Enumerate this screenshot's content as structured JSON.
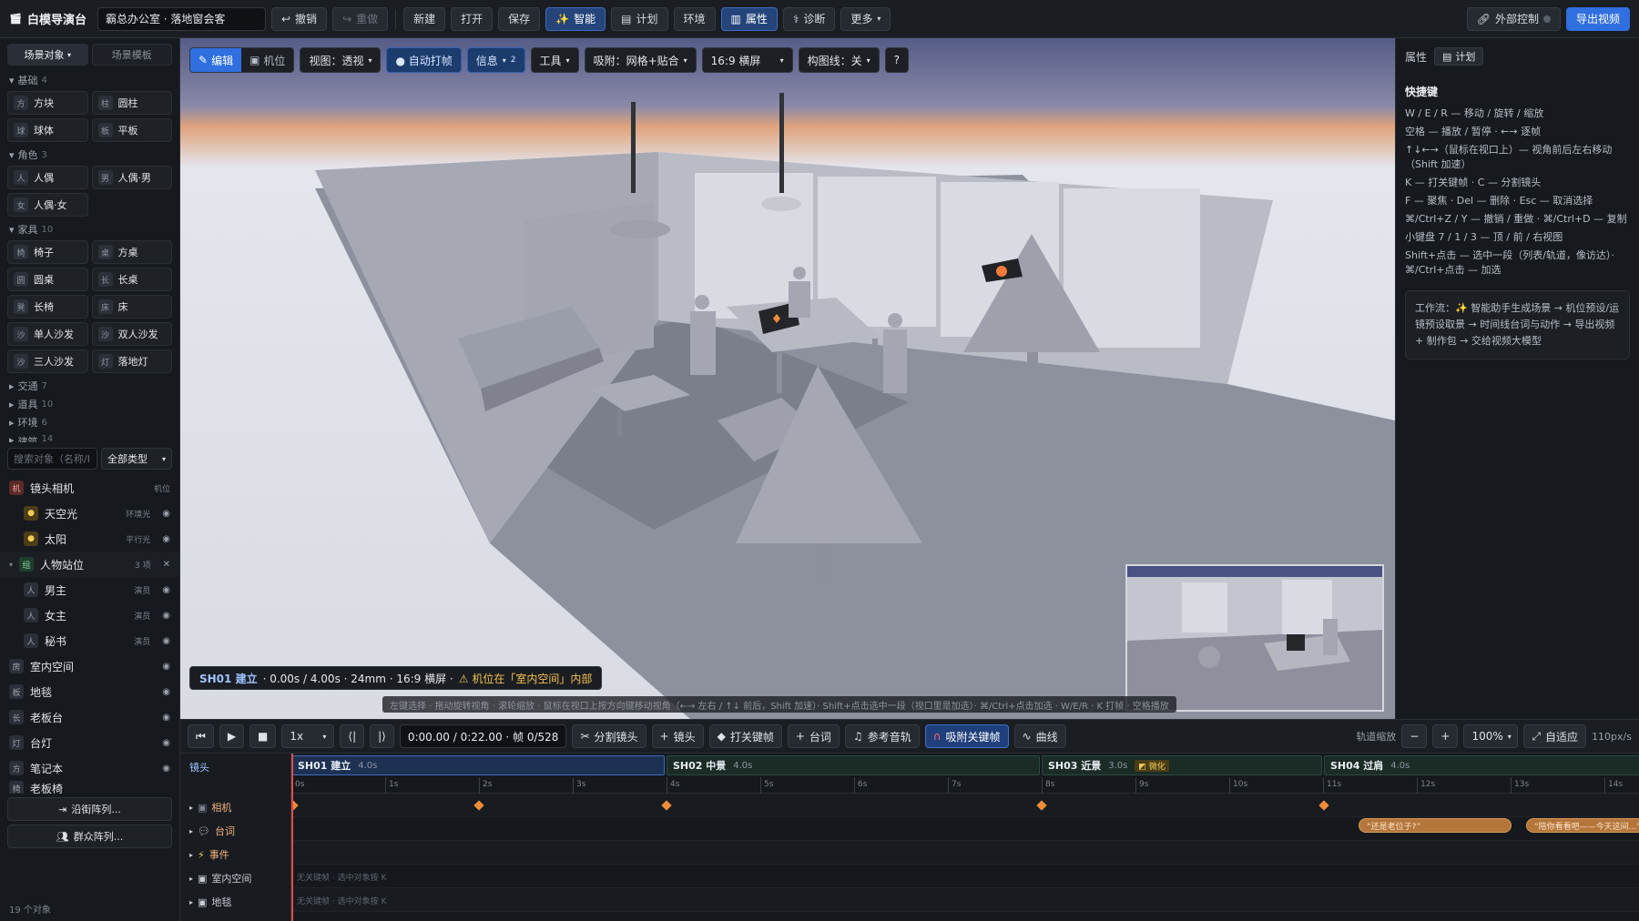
{
  "app": {
    "title": "白模导演台",
    "project": "霸总办公室 · 落地窗会客"
  },
  "toolbar": {
    "undo": "撤销",
    "redo": "重做",
    "new": "新建",
    "open": "打开",
    "save": "保存",
    "smart": "智能",
    "plan": "计划",
    "env": "环境",
    "props": "属性",
    "diag": "诊断",
    "more": "更多",
    "external": "外部控制",
    "export": "导出视频"
  },
  "left": {
    "tabs": [
      "场景对象",
      "场景模板"
    ],
    "categories": {
      "basic": {
        "label": "基础",
        "count": "4",
        "items": [
          [
            "方",
            "方块"
          ],
          [
            "柱",
            "圆柱"
          ],
          [
            "球",
            "球体"
          ],
          [
            "板",
            "平板"
          ]
        ]
      },
      "role": {
        "label": "角色",
        "count": "3",
        "items": [
          [
            "人",
            "人偶"
          ],
          [
            "男",
            "人偶·男"
          ],
          [
            "女",
            "人偶·女"
          ]
        ]
      },
      "furniture": {
        "label": "家具",
        "count": "10",
        "items": [
          [
            "椅",
            "椅子"
          ],
          [
            "桌",
            "方桌"
          ],
          [
            "圆",
            "圆桌"
          ],
          [
            "长",
            "长桌"
          ],
          [
            "凳",
            "长椅"
          ],
          [
            "床",
            "床"
          ],
          [
            "沙",
            "单人沙发"
          ],
          [
            "沙",
            "双人沙发"
          ],
          [
            "沙",
            "三人沙发"
          ],
          [
            "灯",
            "落地灯"
          ]
        ]
      },
      "traffic": {
        "label": "交通",
        "count": "7"
      },
      "props": {
        "label": "道具",
        "count": "10"
      },
      "env": {
        "label": "环境",
        "count": "6"
      },
      "build": {
        "label": "建筑",
        "count": "14"
      }
    },
    "search_placeholder": "搜索对象（名称/I",
    "type_filter": "全部类型",
    "objects": [
      {
        "icon": "机",
        "name": "镜头相机",
        "tag": "机位"
      },
      {
        "icon": "💡",
        "name": "天空光",
        "tag": "环境光"
      },
      {
        "icon": "💡",
        "name": "太阳",
        "tag": "平行光"
      },
      {
        "icon": "组",
        "name": "人物站位",
        "tag": "3 项"
      },
      {
        "icon": "人",
        "name": "男主",
        "tag": "演员"
      },
      {
        "icon": "人",
        "name": "女主",
        "tag": "演员"
      },
      {
        "icon": "人",
        "name": "秘书",
        "tag": "演员"
      },
      {
        "icon": "房",
        "name": "室内空间",
        "tag": ""
      },
      {
        "icon": "板",
        "name": "地毯",
        "tag": ""
      },
      {
        "icon": "长",
        "name": "老板台",
        "tag": ""
      },
      {
        "icon": "灯",
        "name": "台灯",
        "tag": ""
      },
      {
        "icon": "方",
        "name": "笔记本",
        "tag": ""
      },
      {
        "icon": "椅",
        "name": "老板椅",
        "tag": ""
      }
    ],
    "street_array": "沿街阵列...",
    "crowd_array": "群众阵列...",
    "count": "19 个对象"
  },
  "viewport": {
    "edit": "编辑",
    "cam": "机位",
    "view": "视图：透视",
    "autokey": "● 自动打帧",
    "info": "信息",
    "info_count": "2",
    "tools": "工具",
    "snap": "吸附：网格+贴合",
    "ratio": "16:9 横屏",
    "guides": "构图线：关",
    "help": "?",
    "shot_name": "SH01 建立",
    "shot_info": "· 0.00s / 4.00s · 24mm · 16:9 横屏 ·",
    "warning": "⚠ 机位在「室内空间」内部",
    "hint": "左键选择 · 拖动旋转视角 · 滚轮缩放 · 鼠标在视口上按方向键移动视角（←→ 左右 / ↑↓ 前后，Shift 加速）· Shift+点击选中一段（视口里是加选）· ⌘/Ctrl+点击加选 · W/E/R · K 打帧 · 空格播放",
    "colors": {
      "accent": "#2f6fe0",
      "warn": "#f3c24e"
    }
  },
  "right": {
    "title": "属性",
    "plan": "计划",
    "shortcuts_title": "快捷键",
    "shortcuts": [
      "W / E / R — 移动 / 旋转 / 缩放",
      "空格 — 播放 / 暂停 · ←→ 逐帧",
      "↑↓←→（鼠标在视口上）— 视角前后左右移动（Shift 加速）",
      "K — 打关键帧 · C — 分割镜头",
      "F — 聚焦 · Del — 删除 · Esc — 取消选择",
      "⌘/Ctrl+Z / Y — 撤销 / 重做 · ⌘/Ctrl+D — 复制",
      "小键盘 7 / 1 / 3 — 顶 / 前 / 右视图",
      "Shift+点击 — 选中一段（列表/轨道，像访达）· ⌘/Ctrl+点击 — 加选"
    ],
    "workflow": "工作流：✨ 智能助手生成场景 → 机位预设/运镜预设取景 → 时间线台词与动作 → 导出视频 + 制作包 → 交给视频大模型"
  },
  "transport": {
    "speed": "1x",
    "time": "0:00.00 / 0:22.00 · 帧 0/528",
    "split": "分割镜头",
    "shot": "镜头",
    "keyframe": "打关键帧",
    "line": "台词",
    "ref_audio": "参考音轨",
    "snap_key": "吸附关键帧",
    "curve": "曲线",
    "track_zoom": "轨道缩放",
    "zoom": "100%",
    "fit": "自适应",
    "px": "110px/s"
  },
  "timeline": {
    "labels": {
      "shots": "镜头",
      "camera": "相机",
      "dialogue": "台词",
      "event": "事件",
      "room": "室内空间",
      "rug": "地毯"
    },
    "shots": [
      {
        "name": "SH01 建立",
        "dur": "4.0s"
      },
      {
        "name": "SH02 中景",
        "dur": "4.0s"
      },
      {
        "name": "SH03 近景",
        "dur": "3.0s",
        "badge": "◩ 微化"
      },
      {
        "name": "SH04 过肩",
        "dur": "4.0s"
      }
    ],
    "ticks": [
      "0s",
      "1s",
      "2s",
      "3s",
      "4s",
      "5s",
      "6s",
      "7s",
      "8s",
      "9s",
      "10s",
      "11s",
      "12s",
      "13s",
      "14s"
    ],
    "bubbles": [
      "“还是老位子?”",
      "“陪你看看吧——今天这间...”"
    ],
    "empty_hint": "无关键帧 · 选中对象按 K"
  }
}
